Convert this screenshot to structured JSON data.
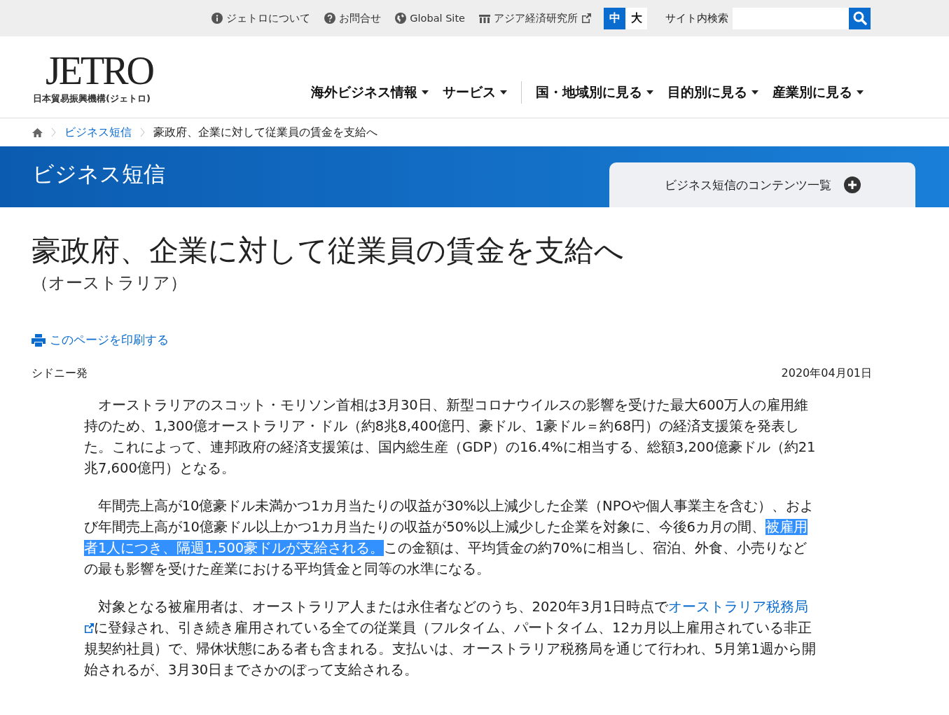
{
  "top_links": [
    {
      "label": "ジェトロについて",
      "kind": "info",
      "external": false
    },
    {
      "label": "お問合せ",
      "kind": "help",
      "external": false
    },
    {
      "label": "Global Site",
      "kind": "globe",
      "external": false
    },
    {
      "label": "アジア経済研究所",
      "kind": "institute",
      "external": true
    }
  ],
  "font_size": [
    {
      "label": "中",
      "selected": true
    },
    {
      "label": "大",
      "selected": false
    }
  ],
  "search": {
    "label": "サイト内検索"
  },
  "logo": {
    "mark": "JETRO",
    "name": "日本貿易振興機構(ジェトロ)"
  },
  "nav": [
    {
      "label": "海外ビジネス情報",
      "separator_before": false
    },
    {
      "label": "サービス",
      "separator_before": false
    },
    {
      "label": "国・地域別に見る",
      "separator_before": true
    },
    {
      "label": "目的別に見る",
      "separator_before": false
    },
    {
      "label": "産業別に見る",
      "separator_before": false
    }
  ],
  "breadcrumb": [
    {
      "label": "ビジネス短信",
      "link": true
    },
    {
      "label": "豪政府、企業に対して従業員の賃金を支給へ",
      "link": false
    }
  ],
  "banner": {
    "title": "ビジネス短信",
    "menu_button": "ビジネス短信のコンテンツ一覧"
  },
  "article": {
    "title": "豪政府、企業に対して従業員の賃金を支給へ",
    "region": "（オーストラリア）",
    "print_link": "このページを印刷する",
    "dateline": "シドニー発",
    "date": "2020年04月01日",
    "paragraphs": [
      [
        {
          "kind": "text",
          "text": "オーストラリアのスコット・モリソン首相は3月30日、新型コロナウイルスの影響を受けた最大600万人の雇用維持のため、1,300億オーストラリア・ドル（約8兆8,400億円、豪ドル、1豪ドル＝約68円）の経済支援策を発表した。これによって、連邦政府の経済支援策は、国内総生産（GDP）の16.4%に相当する、総額3,200億豪ドル（約21兆7,600億円）となる。"
        }
      ],
      [
        {
          "kind": "text",
          "text": "年間売上高が10億豪ドル未満かつ1カ月当たりの収益が30%以上減少した企業（NPOや個人事業主を含む）、および年間売上高が10億豪ドル以上かつ1カ月当たりの収益が50%以上減少した企業を対象に、今後6カ月の間、"
        },
        {
          "kind": "selected",
          "text": "被雇用者1人につき、隔週1,500豪ドルが支給される。"
        },
        {
          "kind": "text",
          "text": "この金額は、平均賃金の約70%に相当し、宿泊、外食、小売りなどの最も影響を受けた産業における平均賃金と同等の水準になる。"
        }
      ],
      [
        {
          "kind": "text",
          "text": "対象となる被雇用者は、オーストラリア人または永住者などのうち、2020年3月1日時点で"
        },
        {
          "kind": "link",
          "text": "オーストラリア税務局"
        },
        {
          "kind": "text",
          "text": "に登録され、引き続き雇用されている全ての従業員（フルタイム、パートタイム、12カ月以上雇用されている非正規契約社員）で、帰休状態にある者も含まれる。支払いは、オーストラリア税務局を通じて行われ、5月第1週から開始されるが、3月30日までさかのぼって支給される。"
        }
      ]
    ]
  }
}
